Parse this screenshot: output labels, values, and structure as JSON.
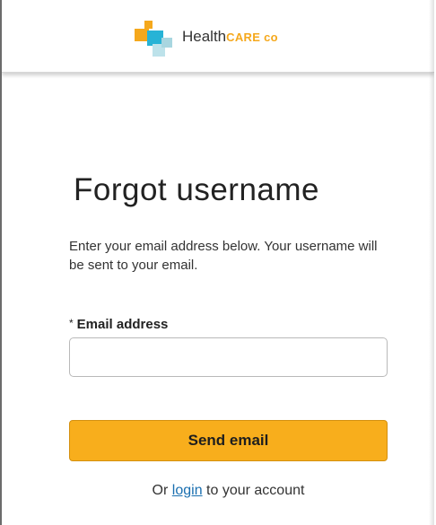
{
  "header": {
    "logo": {
      "brand_main": "Health",
      "brand_accent": "CARE co",
      "colors": {
        "orange": "#f5a81c",
        "blue": "#27b3d6",
        "light_blue": "#bde2ea"
      }
    }
  },
  "page": {
    "title": "Forgot username",
    "instructions": "Enter your email address below. Your username will be sent to your email."
  },
  "form": {
    "email": {
      "required_marker": "*",
      "label": "Email address",
      "value": "",
      "placeholder": ""
    },
    "submit_label": "Send email"
  },
  "footer": {
    "prefix": "Or",
    "link_label": "login",
    "suffix": "to your account"
  },
  "colors": {
    "button_bg": "#f8ae1c",
    "link": "#1a6fb0"
  }
}
